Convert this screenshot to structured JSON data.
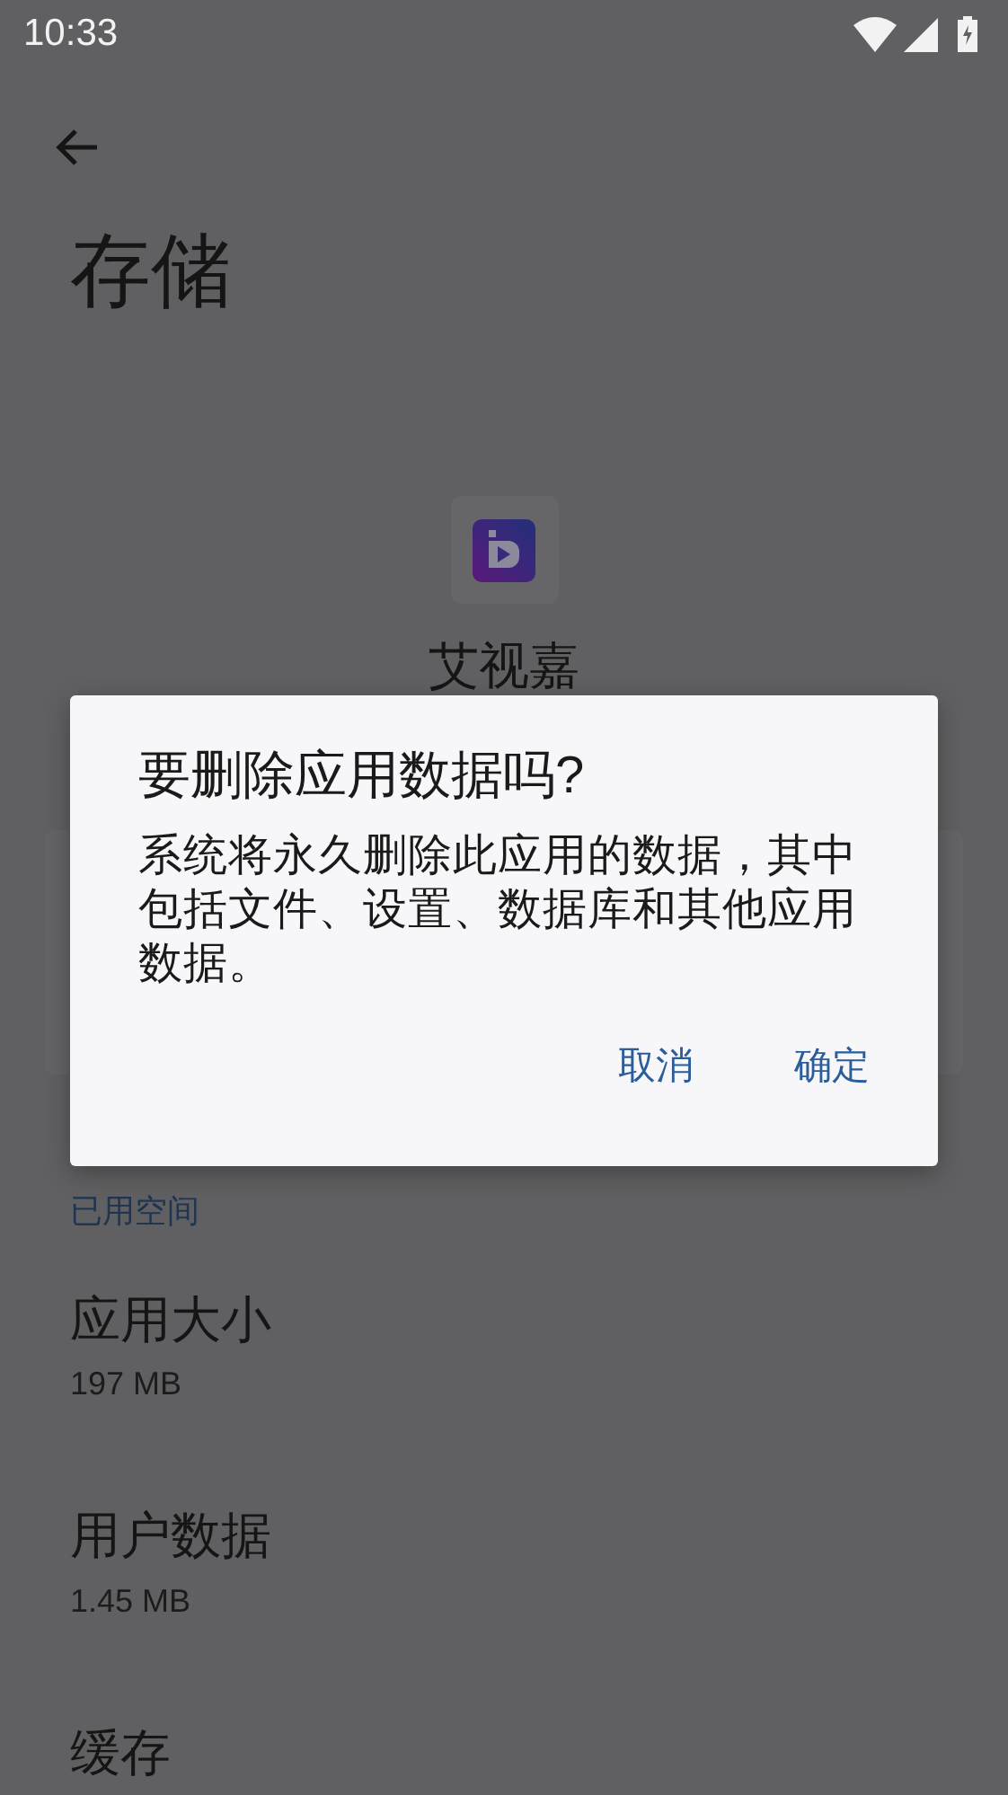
{
  "status_bar": {
    "time": "10:33"
  },
  "page": {
    "title": "存储"
  },
  "app": {
    "name": "艾视嘉"
  },
  "section": {
    "header": "已用空间"
  },
  "items": [
    {
      "label": "应用大小",
      "value": "197 MB"
    },
    {
      "label": "用户数据",
      "value": "1.45 MB"
    },
    {
      "label": "缓存"
    }
  ],
  "dialog": {
    "title": "要删除应用数据吗?",
    "message": "系统将永久删除此应用的数据，其中包括文件、设置、数据库和其他应用数据。",
    "buttons": [
      "取消",
      "确定"
    ]
  }
}
